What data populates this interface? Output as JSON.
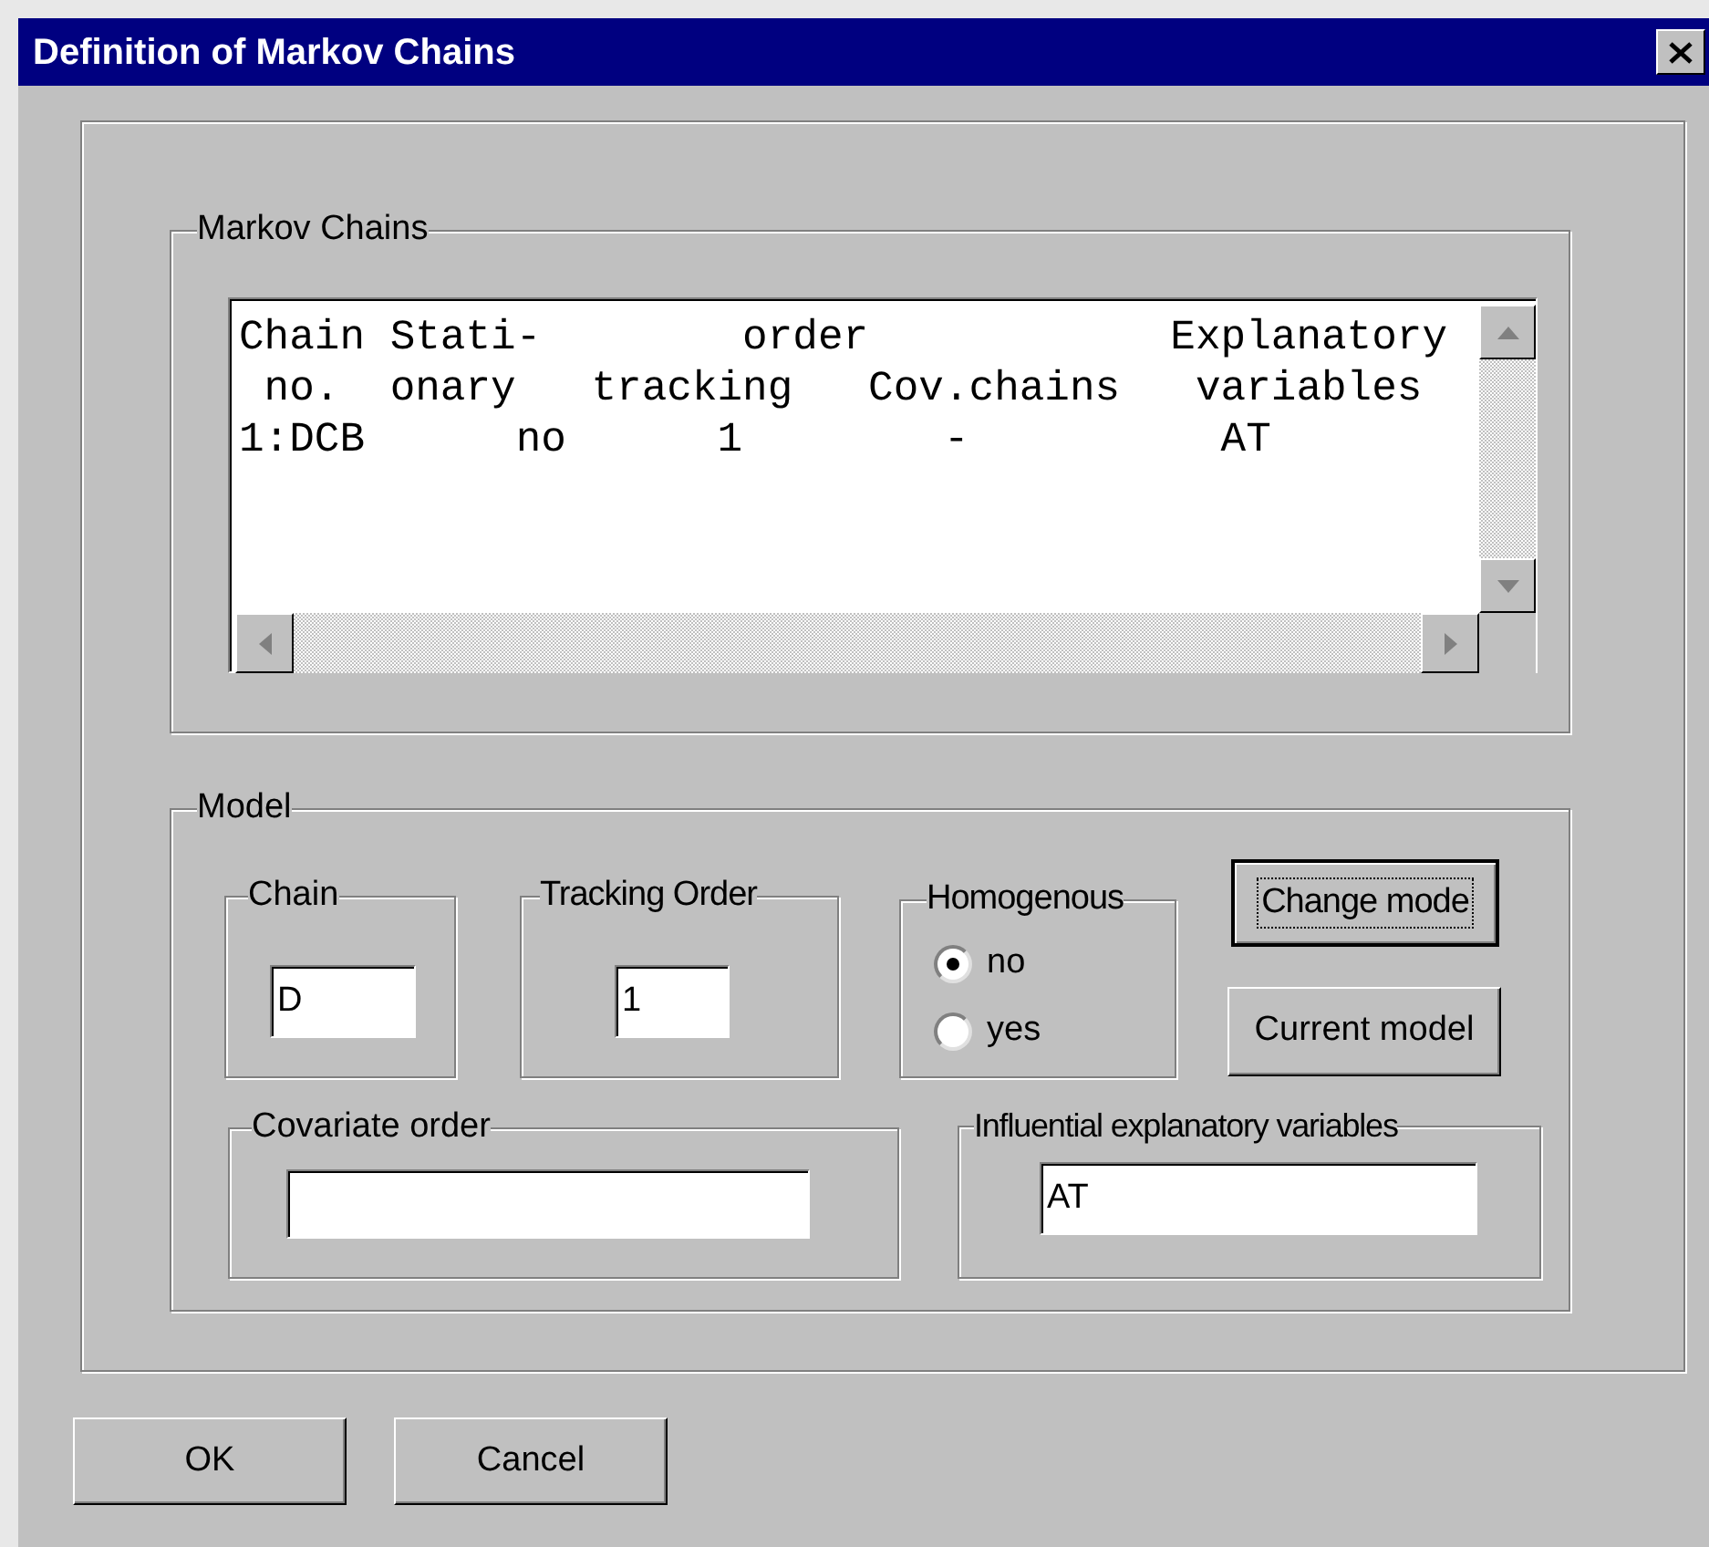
{
  "window": {
    "title": "Definition of Markov Chains"
  },
  "markov_chains": {
    "label": "Markov Chains",
    "lines": [
      "Chain Stati-        order            Explanatory",
      " no.  onary   tracking   Cov.chains   variables",
      "1:DCB      no      1        -          AT"
    ]
  },
  "model": {
    "label": "Model",
    "chain": {
      "label": "Chain",
      "value": "D"
    },
    "tracking_order": {
      "label": "Tracking Order",
      "value": "1"
    },
    "homogenous": {
      "label": "Homogenous",
      "options": [
        {
          "label": "no",
          "selected": true
        },
        {
          "label": "yes",
          "selected": false
        }
      ]
    },
    "buttons": [
      {
        "label": "Change mode",
        "default": true
      },
      {
        "label": "Current model",
        "default": false
      }
    ],
    "covariate_order": {
      "label": "Covariate order"
    },
    "influential": {
      "label": "Influential explanatory variables",
      "value": "AT"
    }
  },
  "buttons": [
    {
      "label": "OK"
    },
    {
      "label": "Cancel"
    }
  ]
}
